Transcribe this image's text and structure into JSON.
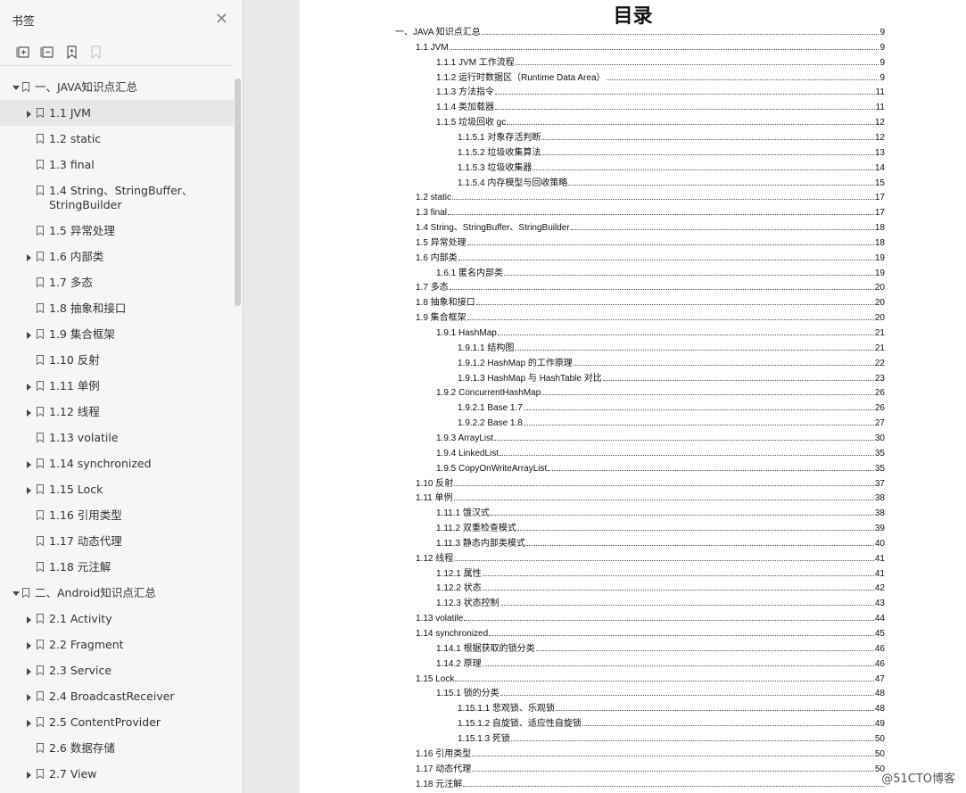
{
  "sidebar": {
    "title": "书签",
    "tools": [
      "expand-all-icon",
      "collapse-all-icon",
      "bookmark-add-icon",
      "bookmark-remove-icon"
    ],
    "items": [
      {
        "label": "一、JAVA知识点汇总",
        "level": 0,
        "caret": "down"
      },
      {
        "label": "1.1 JVM",
        "level": 1,
        "caret": "right",
        "selected": true
      },
      {
        "label": "1.2 static",
        "level": 1,
        "caret": "none"
      },
      {
        "label": "1.3 final",
        "level": 1,
        "caret": "none"
      },
      {
        "label": "1.4 String、StringBuffer、StringBuilder",
        "level": 1,
        "caret": "none",
        "tall": true
      },
      {
        "label": "1.5 异常处理",
        "level": 1,
        "caret": "none"
      },
      {
        "label": "1.6 内部类",
        "level": 1,
        "caret": "right"
      },
      {
        "label": "1.7 多态",
        "level": 1,
        "caret": "none"
      },
      {
        "label": "1.8 抽象和接口",
        "level": 1,
        "caret": "none"
      },
      {
        "label": "1.9 集合框架",
        "level": 1,
        "caret": "right"
      },
      {
        "label": "1.10 反射",
        "level": 1,
        "caret": "none"
      },
      {
        "label": "1.11 单例",
        "level": 1,
        "caret": "right"
      },
      {
        "label": "1.12 线程",
        "level": 1,
        "caret": "right"
      },
      {
        "label": "1.13 volatile",
        "level": 1,
        "caret": "none"
      },
      {
        "label": "1.14 synchronized",
        "level": 1,
        "caret": "right"
      },
      {
        "label": "1.15 Lock",
        "level": 1,
        "caret": "right"
      },
      {
        "label": "1.16 引用类型",
        "level": 1,
        "caret": "none"
      },
      {
        "label": "1.17 动态代理",
        "level": 1,
        "caret": "none"
      },
      {
        "label": "1.18 元注解",
        "level": 1,
        "caret": "none"
      },
      {
        "label": "二、Android知识点汇总",
        "level": 0,
        "caret": "down"
      },
      {
        "label": "2.1 Activity",
        "level": 1,
        "caret": "right"
      },
      {
        "label": "2.2 Fragment",
        "level": 1,
        "caret": "right"
      },
      {
        "label": "2.3 Service",
        "level": 1,
        "caret": "right"
      },
      {
        "label": "2.4 BroadcastReceiver",
        "level": 1,
        "caret": "right"
      },
      {
        "label": "2.5 ContentProvider",
        "level": 1,
        "caret": "right"
      },
      {
        "label": "2.6 数据存储",
        "level": 1,
        "caret": "none"
      },
      {
        "label": "2.7 View",
        "level": 1,
        "caret": "right"
      }
    ]
  },
  "document": {
    "title": "目录",
    "toc": [
      {
        "text": "一、JAVA 知识点汇总",
        "page": "9",
        "level": 0
      },
      {
        "text": "1.1 JVM",
        "page": "9",
        "level": 1
      },
      {
        "text": "1.1.1  JVM  工作流程",
        "page": "9",
        "level": 2
      },
      {
        "text": "1.1.2  运行时数据区（Runtime Data Area）",
        "page": "9",
        "level": 2
      },
      {
        "text": "1.1.3  方法指令",
        "page": "11",
        "level": 2
      },
      {
        "text": "1.1.4  类加载器",
        "page": "11",
        "level": 2
      },
      {
        "text": "1.1.5  垃圾回收  gc",
        "page": "12",
        "level": 2
      },
      {
        "text": "1.1.5.1  对象存活判断",
        "page": "12",
        "level": 3
      },
      {
        "text": "1.1.5.2  垃圾收集算法",
        "page": "13",
        "level": 3
      },
      {
        "text": "1.1.5.3  垃圾收集器",
        "page": "14",
        "level": 3
      },
      {
        "text": "1.1.5.4  内存模型与回收策略",
        "page": "15",
        "level": 3
      },
      {
        "text": "1.2 static",
        "page": "17",
        "level": 1
      },
      {
        "text": "1.3 final",
        "page": "17",
        "level": 1
      },
      {
        "text": "1.4 String、StringBuffer、StringBuilder",
        "page": "18",
        "level": 1
      },
      {
        "text": "1.5  异常处理",
        "page": "18",
        "level": 1
      },
      {
        "text": "1.6  内部类",
        "page": "19",
        "level": 1
      },
      {
        "text": "1.6.1  匿名内部类",
        "page": "19",
        "level": 2
      },
      {
        "text": "1.7  多态",
        "page": "20",
        "level": 1
      },
      {
        "text": "1.8  抽象和接口",
        "page": "20",
        "level": 1
      },
      {
        "text": "1.9  集合框架",
        "page": "20",
        "level": 1
      },
      {
        "text": "1.9.1 HashMap",
        "page": "21",
        "level": 2
      },
      {
        "text": "1.9.1.1  结构图",
        "page": "21",
        "level": 3
      },
      {
        "text": "1.9.1.2 HashMap  的工作原理",
        "page": "22",
        "level": 3
      },
      {
        "text": "1.9.1.3 HashMap  与  HashTable  对比",
        "page": "23",
        "level": 3
      },
      {
        "text": "1.9.2 ConcurrentHashMap",
        "page": "26",
        "level": 2
      },
      {
        "text": "1.9.2.1 Base 1.7",
        "page": "26",
        "level": 3
      },
      {
        "text": "1.9.2.2 Base 1.8",
        "page": "27",
        "level": 3
      },
      {
        "text": "1.9.3 ArrayList",
        "page": "30",
        "level": 2
      },
      {
        "text": "1.9.4 LinkedList",
        "page": "35",
        "level": 2
      },
      {
        "text": "1.9.5 CopyOnWriteArrayList",
        "page": "35",
        "level": 2
      },
      {
        "text": "1.10  反射",
        "page": "37",
        "level": 1
      },
      {
        "text": "1.11  单例",
        "page": "38",
        "level": 1
      },
      {
        "text": "1.11.1  饿汉式",
        "page": "38",
        "level": 2
      },
      {
        "text": "1.11.2  双重检查模式",
        "page": "39",
        "level": 2
      },
      {
        "text": "1.11.3  静态内部类模式",
        "page": "40",
        "level": 2
      },
      {
        "text": "1.12  线程",
        "page": "41",
        "level": 1
      },
      {
        "text": "1.12.1  属性",
        "page": "41",
        "level": 2
      },
      {
        "text": "1.12.2  状态",
        "page": "42",
        "level": 2
      },
      {
        "text": "1.12.3  状态控制",
        "page": "43",
        "level": 2
      },
      {
        "text": "1.13 volatile",
        "page": "44",
        "level": 1
      },
      {
        "text": "1.14 synchronized",
        "page": "45",
        "level": 1
      },
      {
        "text": "1.14.1  根据获取的锁分类",
        "page": "46",
        "level": 2
      },
      {
        "text": "1.14.2  原理",
        "page": "46",
        "level": 2
      },
      {
        "text": "1.15 Lock",
        "page": "47",
        "level": 1
      },
      {
        "text": "1.15.1  锁的分类",
        "page": "48",
        "level": 2
      },
      {
        "text": "1.15.1.1  悲观锁、乐观锁",
        "page": "48",
        "level": 3
      },
      {
        "text": "1.15.1.2  自旋锁、适应性自旋锁",
        "page": "49",
        "level": 3
      },
      {
        "text": "1.15.1.3  死锁",
        "page": "50",
        "level": 3
      },
      {
        "text": "1.16  引用类型",
        "page": "50",
        "level": 1
      },
      {
        "text": "1.17  动态代理",
        "page": "50",
        "level": 1
      },
      {
        "text": "1.18  元注解",
        "page": "",
        "level": 1
      }
    ]
  },
  "watermark": "@51CTO博客"
}
